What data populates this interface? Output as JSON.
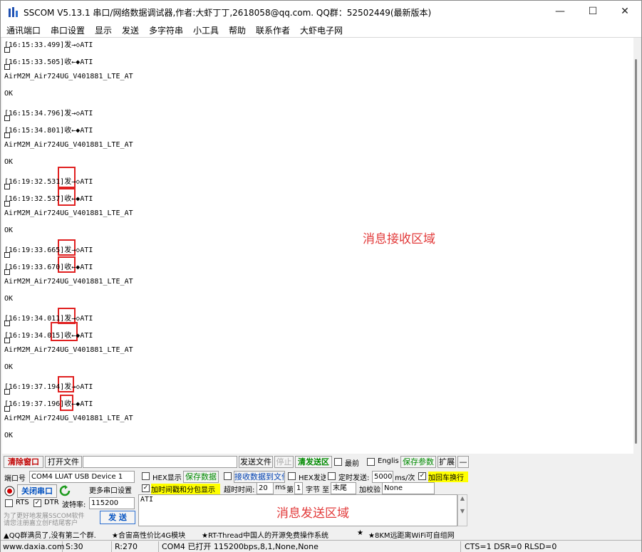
{
  "window": {
    "title": "SSCOM V5.13.1 串口/网络数据调试器,作者:大虾丁丁,2618058@qq.com. QQ群：52502449(最新版本)",
    "controls": [
      "—",
      "☐",
      "✕"
    ]
  },
  "menu": [
    "通讯端口",
    "串口设置",
    "显示",
    "发送",
    "多字符串",
    "小工具",
    "帮助",
    "联系作者",
    "大虾电子网"
  ],
  "receive": {
    "lines": [
      "[16:15:33.499]发→◇ATI",
      "",
      "[16:15:33.505]收←◆ATI",
      "",
      "AirM2M_Air724UG_V401881_LTE_AT",
      "",
      "OK",
      "",
      "[16:15:34.796]发→◇ATI",
      "",
      "[16:15:34.801]收←◆ATI",
      "",
      "AirM2M_Air724UG_V401881_LTE_AT",
      "",
      "OK",
      "",
      "[16:19:32.531]发→◇ATI",
      "",
      "[16:19:32.537]收←◆ATI",
      "",
      "AirM2M_Air724UG_V401881_LTE_AT",
      "",
      "OK",
      "",
      "[16:19:33.665]发→◇ATI",
      "",
      "[16:19:33.670]收←◆ATI",
      "",
      "AirM2M_Air724UG_V401881_LTE_AT",
      "",
      "OK",
      "",
      "[16:19:34.011]发→◇ATI",
      "",
      "[16:19:34.015]收←◆ATI",
      "",
      "AirM2M_Air724UG_V401881_LTE_AT",
      "",
      "OK",
      "",
      "[16:19:37.194]发→◇ATI",
      "",
      "[16:19:37.196]收←◆ATI",
      "",
      "AirM2M_Air724UG_V401881_LTE_AT",
      "",
      "OK"
    ],
    "caption": "消息接收区域"
  },
  "toolbar": {
    "clear_window": "清除窗口",
    "open_file": "打开文件",
    "send_file": "发送文件",
    "stop": "停止",
    "clear_send": "清发送区",
    "topmost": "最前",
    "english": "English",
    "save_params": "保存参数",
    "expand": "扩展",
    "collapse": "—"
  },
  "port": {
    "port_label": "端口号",
    "port_value": "COM4 LUAT USB Device 1",
    "close_port": "关闭串口",
    "more_settings": "更多串口设置",
    "rts": "RTS",
    "dtr": "DTR",
    "baud_label": "波特率:",
    "baud_value": "115200",
    "promo_line1": "为了更好地发展SSCOM软件",
    "promo_line2": "请您注册嘉立创F结尾客户"
  },
  "options": {
    "hex_display": "HEX显示",
    "save_data": "保存数据",
    "recv_to_file": "接收数据到文件",
    "hex_send": "HEX发送",
    "timed_send": "定时发送:",
    "interval_value": "5000",
    "interval_unit": "ms/次",
    "add_crlf": "加回车换行",
    "timestamp": "加时间戳和分包显示",
    "timeout_label": "超时时间:",
    "timeout_value": "20",
    "timeout_unit": "ms",
    "byte_label1": "第",
    "byte_value": "1",
    "byte_label2": "字节 至",
    "end_value": "末尾",
    "checksum_label": "加校验",
    "checksum_value": "None",
    "send_button": "发 送"
  },
  "send": {
    "text": "ATI",
    "caption": "消息发送区域"
  },
  "promo_bar": [
    "▲QQ群满员了,没有第二个群.",
    "★合宙高性价比4G模块",
    "★RT-Thread中国人的开源免费操作系统",
    "★",
    "★8KM远距离WiFi可自组网"
  ],
  "status": {
    "site": "www.daxia.com",
    "sent": "S:30",
    "received": "R:270",
    "port_status": "COM4 已打开  115200bps,8,1,None,None",
    "lines": "CTS=1 DSR=0 RLSD=0"
  },
  "colors": {
    "annotation": "#e23a3a",
    "highlight_box": "#e02020",
    "green_text": "#008a00",
    "yellow_highlight": "#ffff00"
  }
}
